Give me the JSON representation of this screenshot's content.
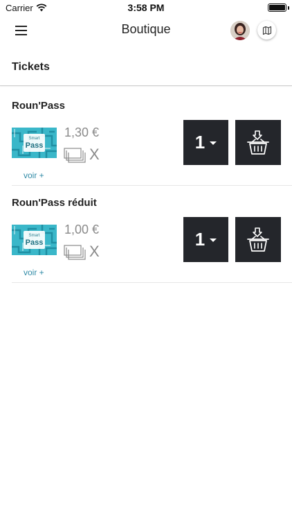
{
  "status_bar": {
    "carrier": "Carrier",
    "time": "3:58 PM"
  },
  "nav": {
    "title": "Boutique",
    "menu_icon": "hamburger-menu-icon",
    "map_icon": "map-icon"
  },
  "section": {
    "title": "Tickets"
  },
  "products": [
    {
      "name": "Roun'Pass",
      "price": "1,30 €",
      "quantity_multiplier": "X",
      "quantity": "1",
      "more_label": "voir +",
      "card_brand_top": "Smart",
      "card_brand_main": "Pass"
    },
    {
      "name": "Roun'Pass réduit",
      "price": "1,00 €",
      "quantity_multiplier": "X",
      "quantity": "1",
      "more_label": "voir +",
      "card_brand_top": "Smart",
      "card_brand_main": "Pass"
    }
  ],
  "colors": {
    "accent_link": "#2f8aa6",
    "button_dark": "#24262b",
    "price_gray": "#8a8a8a",
    "ticket_teal": "#3ab7c9"
  }
}
